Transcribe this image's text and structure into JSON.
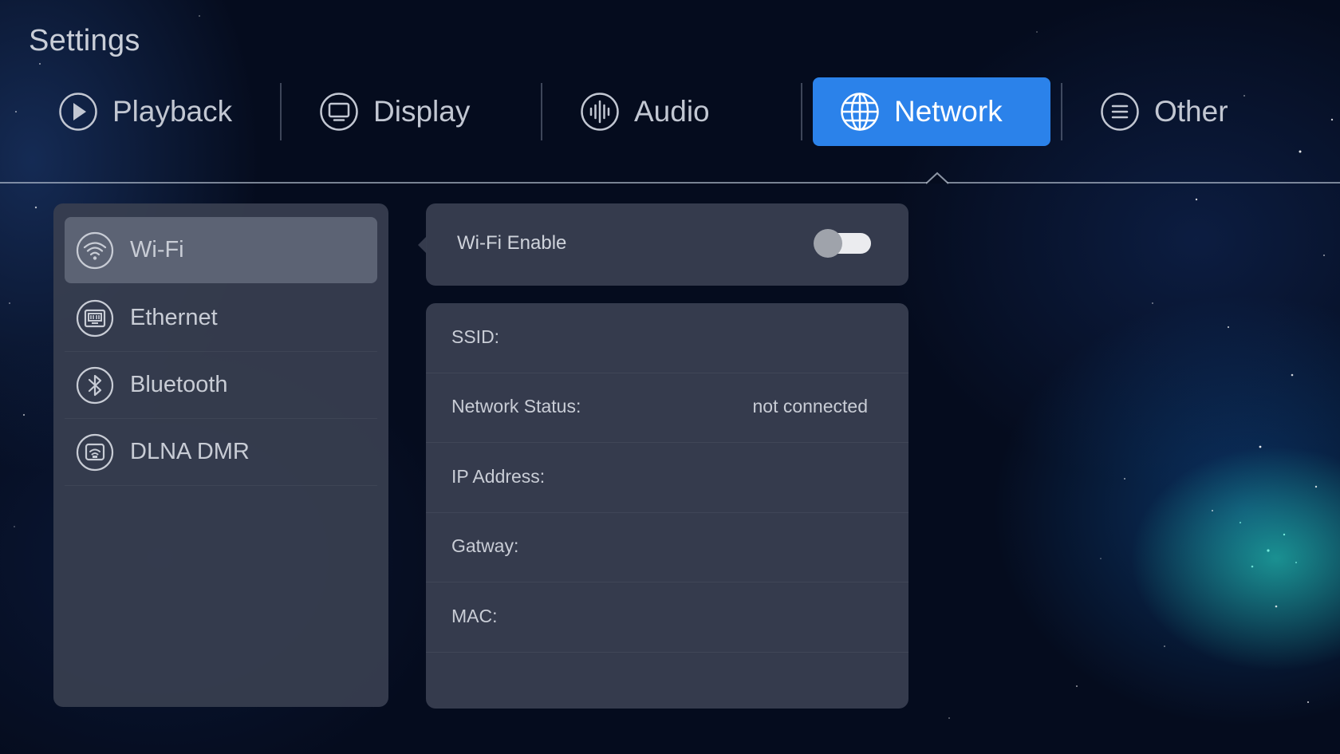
{
  "app": {
    "title": "Settings"
  },
  "tabs": [
    {
      "label": "Playback",
      "icon": "play-icon",
      "active": false
    },
    {
      "label": "Display",
      "icon": "monitor-icon",
      "active": false
    },
    {
      "label": "Audio",
      "icon": "waveform-icon",
      "active": false
    },
    {
      "label": "Network",
      "icon": "globe-icon",
      "active": true
    },
    {
      "label": "Other",
      "icon": "menu-lines-icon",
      "active": false
    }
  ],
  "sidebar": {
    "items": [
      {
        "label": "Wi-Fi",
        "icon": "wifi-icon",
        "selected": true
      },
      {
        "label": "Ethernet",
        "icon": "ethernet-icon",
        "selected": false
      },
      {
        "label": "Bluetooth",
        "icon": "bluetooth-icon",
        "selected": false
      },
      {
        "label": "DLNA DMR",
        "icon": "cast-icon",
        "selected": false
      }
    ]
  },
  "wifi": {
    "enable_label": "Wi-Fi Enable",
    "enabled": false,
    "info": [
      {
        "label": "SSID:",
        "value": ""
      },
      {
        "label": "Network Status:",
        "value": "not connected"
      },
      {
        "label": "IP Address:",
        "value": ""
      },
      {
        "label": "Gatway:",
        "value": ""
      },
      {
        "label": "MAC:",
        "value": ""
      }
    ]
  },
  "colors": {
    "accent": "#2b82ea",
    "panel": "#383e50",
    "selected_item": "#5c6374",
    "background": "#050c1e",
    "nebula": "#28e6c8"
  }
}
